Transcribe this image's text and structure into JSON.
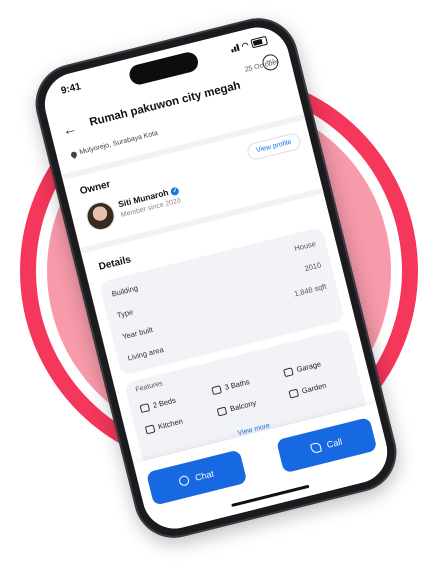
{
  "status_bar": {
    "time": "9:41"
  },
  "header": {
    "back_icon": "arrow-left-icon",
    "title": "Rumah pakuwon city megah",
    "date": "25 October",
    "menu_icon": "more-horizontal-icon"
  },
  "location": {
    "text": "Mulyorejo, Surabaya Kota",
    "icon": "map-pin-icon"
  },
  "owner": {
    "section_label": "Owner",
    "name": "Siti Munaroh",
    "verified_icon": "verified-badge-icon",
    "member_since": "Member since 2020",
    "view_profile_label": "View profile"
  },
  "details": {
    "section_label": "Details",
    "rows": [
      {
        "key": "Building",
        "value": "House"
      },
      {
        "key": "Type",
        "value": "2010"
      },
      {
        "key": "Year built",
        "value": "1,848 sqft"
      },
      {
        "key": "Living area",
        "value": ""
      }
    ]
  },
  "features": {
    "label": "Features",
    "items": [
      {
        "label": "2 Beds",
        "icon": "bed-icon"
      },
      {
        "label": "3 Baths",
        "icon": "shower-icon"
      },
      {
        "label": "Garage",
        "icon": "garage-icon"
      },
      {
        "label": "Kitchen",
        "icon": "kitchen-icon"
      },
      {
        "label": "Balcony",
        "icon": "balcony-icon"
      },
      {
        "label": "Garden",
        "icon": "garden-icon"
      }
    ],
    "view_more_label": "View more"
  },
  "actions": {
    "chat_label": "Chat",
    "chat_icon": "chat-bubble-icon",
    "call_label": "Call",
    "call_icon": "phone-icon"
  },
  "colors": {
    "accent": "#1669e0",
    "ring": "#f4375a",
    "disc": "#f79aaa"
  }
}
